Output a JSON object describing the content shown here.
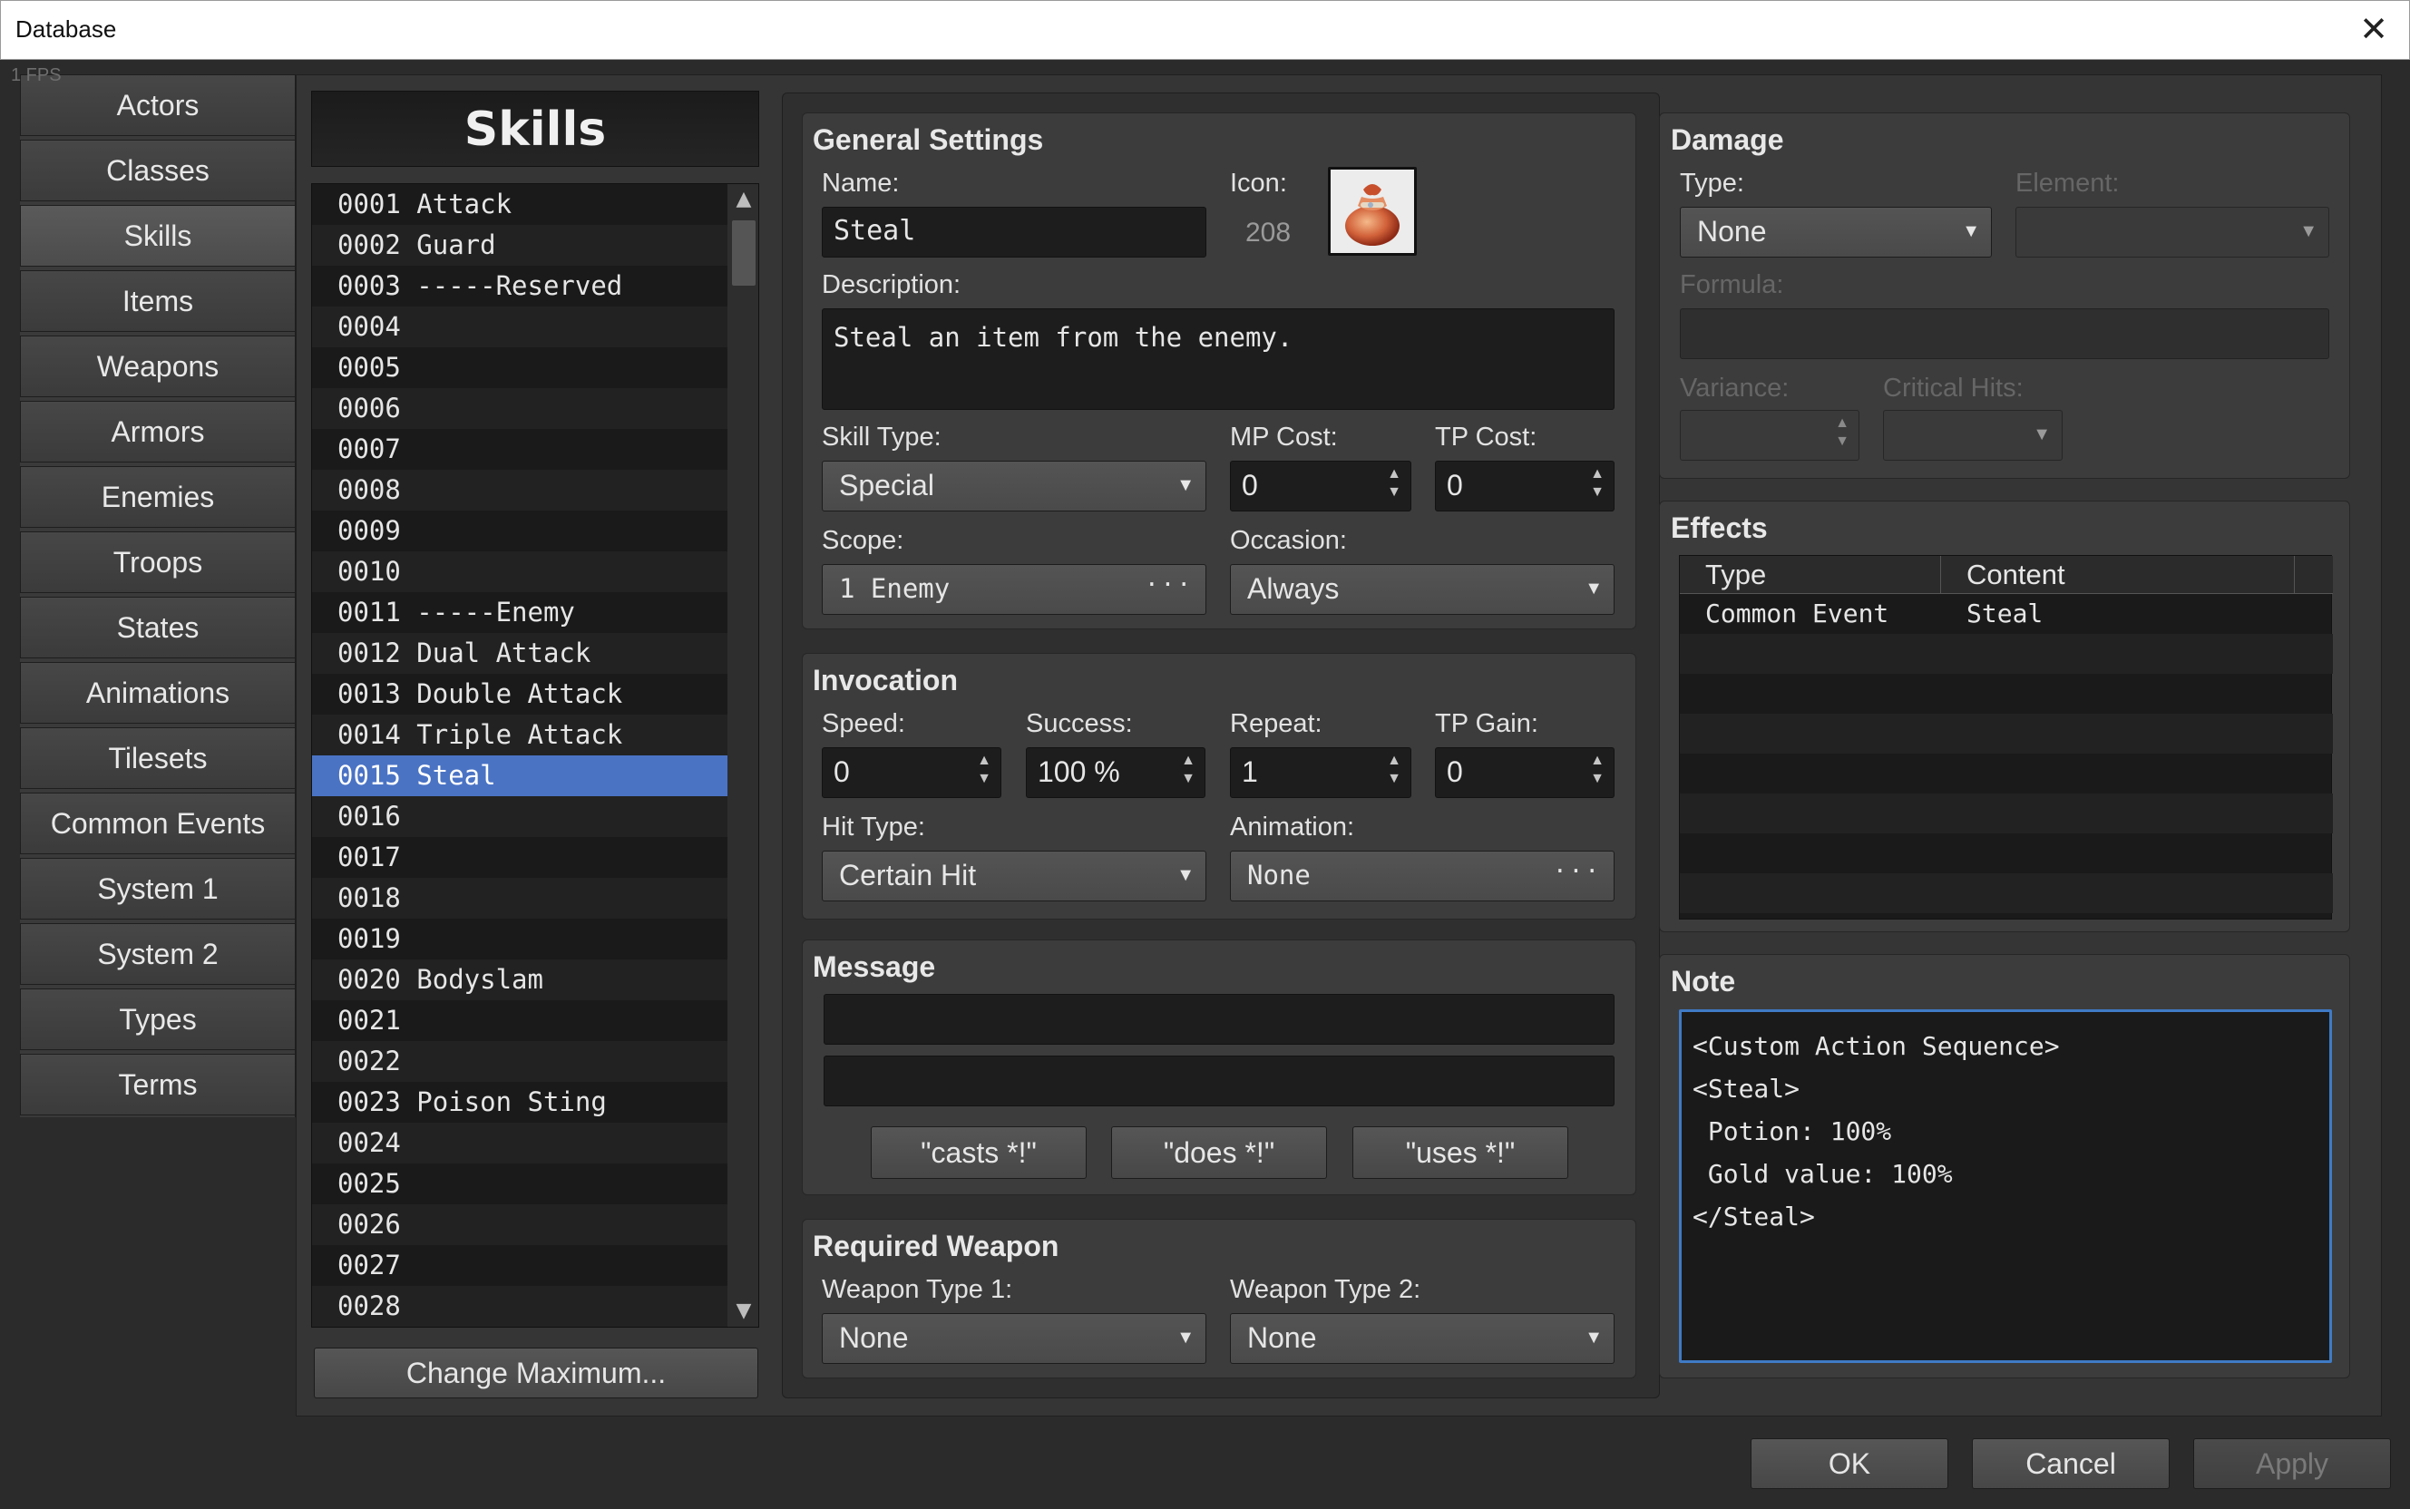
{
  "window": {
    "title": "Database",
    "close_icon": "✕",
    "fps": "1 FPS"
  },
  "categories": [
    "Actors",
    "Classes",
    "Skills",
    "Items",
    "Weapons",
    "Armors",
    "Enemies",
    "Troops",
    "States",
    "Animations",
    "Tilesets",
    "Common Events",
    "System 1",
    "System 2",
    "Types",
    "Terms"
  ],
  "selected_category": "Skills",
  "skills_list": {
    "header": "Skills",
    "rows": [
      "0001 Attack",
      "0002 Guard",
      "0003 -----Reserved",
      "0004",
      "0005",
      "0006",
      "0007",
      "0008",
      "0009",
      "0010",
      "0011 -----Enemy",
      "0012 Dual Attack",
      "0013 Double Attack",
      "0014 Triple Attack",
      "0015 Steal",
      "0016",
      "0017",
      "0018",
      "0019",
      "0020 Bodyslam",
      "0021",
      "0022",
      "0023 Poison Sting",
      "0024",
      "0025",
      "0026",
      "0027",
      "0028"
    ],
    "selected_index": 14,
    "change_max_label": "Change Maximum..."
  },
  "general": {
    "title": "General Settings",
    "name_label": "Name:",
    "name_value": "Steal",
    "icon_label": "Icon:",
    "icon_index": "208",
    "description_label": "Description:",
    "description_value": "Steal an item from the enemy.",
    "skill_type_label": "Skill Type:",
    "skill_type_value": "Special",
    "mp_cost_label": "MP Cost:",
    "mp_cost_value": "0",
    "tp_cost_label": "TP Cost:",
    "tp_cost_value": "0",
    "scope_label": "Scope:",
    "scope_value": "1 Enemy",
    "occasion_label": "Occasion:",
    "occasion_value": "Always"
  },
  "invocation": {
    "title": "Invocation",
    "speed_label": "Speed:",
    "speed_value": "0",
    "success_label": "Success:",
    "success_value": "100 %",
    "repeat_label": "Repeat:",
    "repeat_value": "1",
    "tp_gain_label": "TP Gain:",
    "tp_gain_value": "0",
    "hit_type_label": "Hit Type:",
    "hit_type_value": "Certain Hit",
    "animation_label": "Animation:",
    "animation_value": "None"
  },
  "message": {
    "title": "Message",
    "line1": "",
    "line2": "",
    "btn_casts": "\"casts *!\"",
    "btn_does": "\"does *!\"",
    "btn_uses": "\"uses *!\""
  },
  "required_weapon": {
    "title": "Required Weapon",
    "type1_label": "Weapon Type 1:",
    "type1_value": "None",
    "type2_label": "Weapon Type 2:",
    "type2_value": "None"
  },
  "damage": {
    "title": "Damage",
    "type_label": "Type:",
    "type_value": "None",
    "element_label": "Element:",
    "element_value": "",
    "formula_label": "Formula:",
    "formula_value": "",
    "variance_label": "Variance:",
    "variance_value": "",
    "critical_label": "Critical Hits:",
    "critical_value": ""
  },
  "effects": {
    "title": "Effects",
    "col_type": "Type",
    "col_content": "Content",
    "rows": [
      {
        "type": "Common Event",
        "content": "Steal"
      }
    ]
  },
  "note": {
    "title": "Note",
    "lines": [
      "<Custom Action Sequence>",
      "<Steal>",
      " Potion: 100%",
      " Gold value: 100%",
      "</Steal>"
    ]
  },
  "footer": {
    "ok": "OK",
    "cancel": "Cancel",
    "apply": "Apply"
  }
}
